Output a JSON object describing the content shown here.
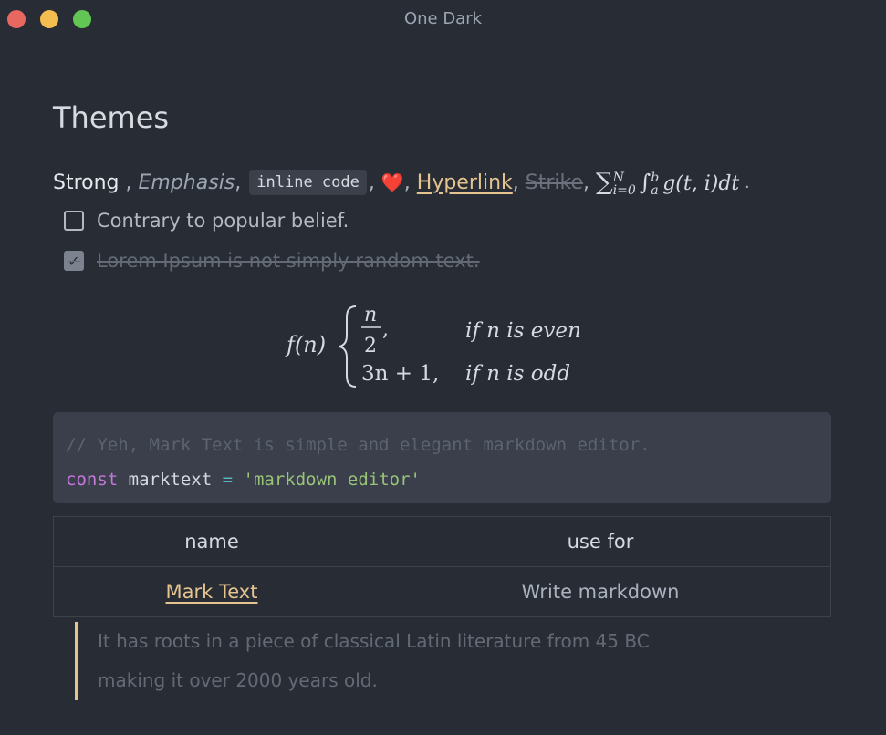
{
  "window": {
    "title": "One Dark"
  },
  "heading": "Themes",
  "inline": {
    "strong": "Strong",
    "sep1": " , ",
    "emphasis": "Emphasis",
    "sep2": ", ",
    "code": "inline code",
    "sep3": ", ",
    "emoji": "❤️",
    "sep4": ", ",
    "link": "Hyperlink",
    "sep5": ", ",
    "strike": "Strike",
    "sep6": ", ",
    "math_sum": "∑",
    "math_sum_sup": "N",
    "math_sum_sub": "i=0",
    "math_int": "∫",
    "math_int_sup": "b",
    "math_int_sub": "a",
    "math_body": "g(t, i)dt",
    "end": " ."
  },
  "tasks": [
    {
      "label": "Contrary to popular belief.",
      "checked": false
    },
    {
      "label": "Lorem Ipsum is not simply random text.",
      "checked": true
    }
  ],
  "formula": {
    "lhs": "f(n)",
    "num": "n",
    "den": "2",
    "case1_comma": ",",
    "cond1": "if n is even",
    "case2": "3n + 1,",
    "cond2": "if n is odd"
  },
  "code": {
    "comment": "// Yeh, Mark Text is simple and elegant markdown editor.",
    "keyword": "const",
    "identifier": "marktext",
    "operator": "=",
    "string": "'markdown editor'"
  },
  "table": {
    "headers": [
      "name",
      "use for"
    ],
    "rows": [
      [
        "Mark Text",
        "Write markdown"
      ]
    ]
  },
  "blockquote": [
    "It has roots in a piece of classical Latin literature from 45 BC",
    "making it over 2000 years old."
  ],
  "colors": {
    "background": "#282c34",
    "link": "#e5c48f",
    "keyword": "#c678dd",
    "string": "#98c379",
    "operator": "#56b6c2"
  }
}
